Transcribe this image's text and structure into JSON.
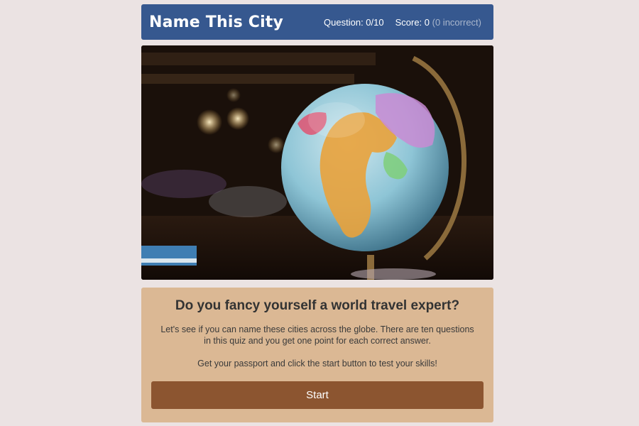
{
  "header": {
    "title": "Name This City",
    "question_label": "Question: 0/10",
    "score_label": "Score: 0",
    "incorrect_label": "(0 incorrect)"
  },
  "intro": {
    "heading": "Do you fancy yourself a world travel expert?",
    "paragraph1": "Let's see if you can name these cities across the globe. There are ten questions in this quiz and you get one point for each correct answer.",
    "paragraph2": "Get your passport and click the start button to test your skills!",
    "start_button": "Start"
  },
  "colors": {
    "background": "#ebe3e3",
    "header": "#36588f",
    "panel": "#dbb894",
    "button": "#8c5530"
  }
}
